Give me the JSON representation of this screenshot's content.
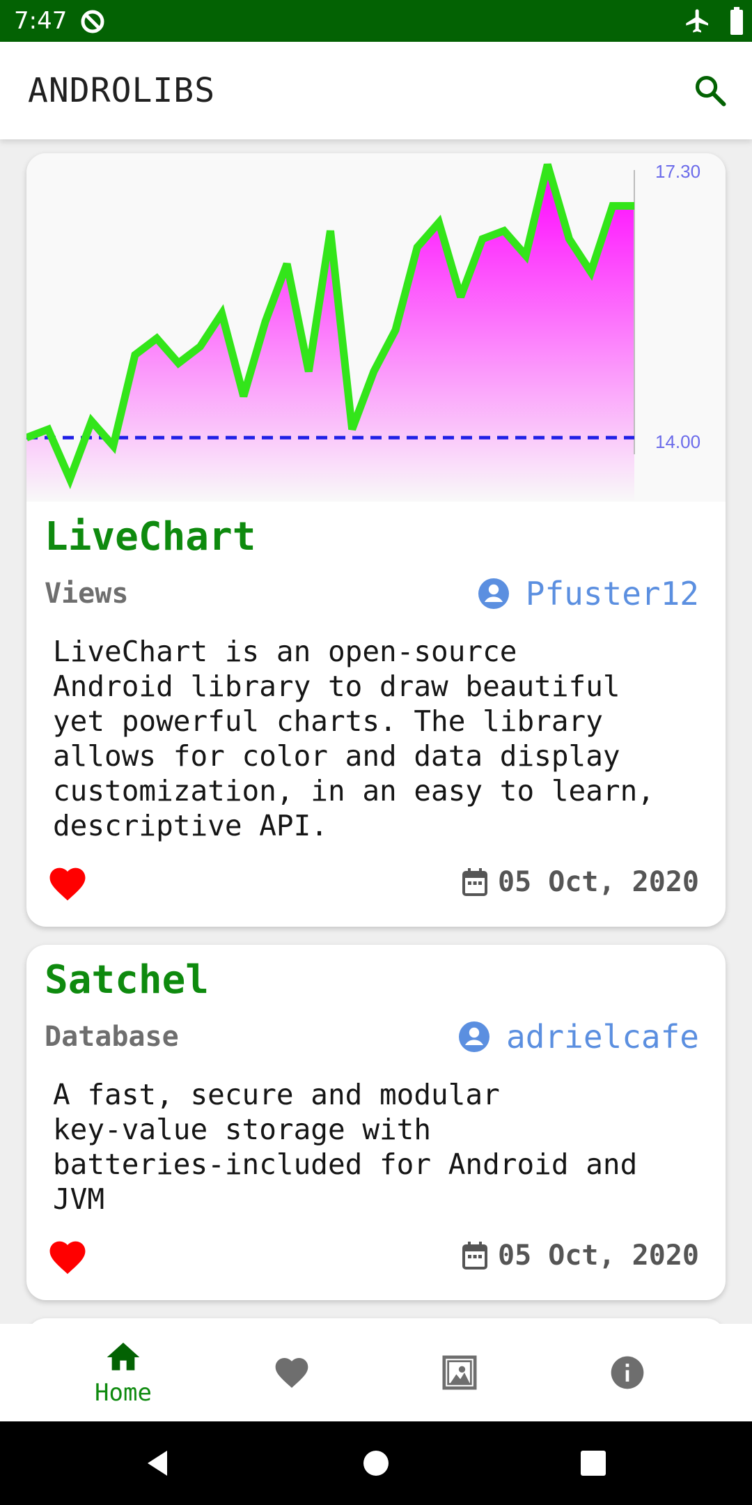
{
  "status_bar": {
    "time": "7:47",
    "icons": [
      "q-app-icon",
      "airplane-mode-icon",
      "battery-icon"
    ]
  },
  "app_bar": {
    "title": "ANDROLIBS",
    "search_icon": "search-icon"
  },
  "colors": {
    "primary": "#036203",
    "accent_green": "#0E8A0E",
    "author_blue": "#5B8FE0",
    "heart_red": "#FF0000",
    "chart_line": "#33E51A",
    "chart_fill": "#FF00FF",
    "baseline": "#1F1FE6"
  },
  "libraries": [
    {
      "name": "LiveChart",
      "category": "Views",
      "author": "Pfuster12",
      "description": "LiveChart is an open-source\nAndroid library to draw beautiful\nyet powerful charts. The library\nallows for color and data display\ncustomization, in an easy to learn,\ndescriptive API.",
      "date": "05 Oct, 2020",
      "favorited": true
    },
    {
      "name": "Satchel",
      "category": "Database",
      "author": "adrielcafe",
      "description": "A fast, secure and modular\nkey-value storage with\nbatteries-included for Android and\nJVM",
      "date": "05 Oct, 2020",
      "favorited": true
    }
  ],
  "chart_data": {
    "type": "area",
    "y_axis_labels": {
      "top": "17.30",
      "bottom": "14.00"
    },
    "ylim": [
      14.0,
      17.3
    ],
    "baseline": 14.1,
    "x": [
      0,
      1,
      2,
      3,
      4,
      5,
      6,
      7,
      8,
      9,
      10,
      11,
      12,
      13,
      14,
      15,
      16,
      17,
      18,
      19,
      20,
      21,
      22,
      23,
      24,
      25,
      26,
      27,
      28
    ],
    "values": [
      14.1,
      14.2,
      13.6,
      14.3,
      14.0,
      15.1,
      15.3,
      15.0,
      15.2,
      15.6,
      14.6,
      15.5,
      16.2,
      14.9,
      16.6,
      14.2,
      14.9,
      15.4,
      16.4,
      16.7,
      15.8,
      16.5,
      16.6,
      16.3,
      17.4,
      16.5,
      16.1,
      16.9,
      16.9
    ],
    "grid": false,
    "legend": "none"
  },
  "bottom_nav": {
    "items": [
      {
        "icon": "home-icon",
        "label": "Home",
        "active": true
      },
      {
        "icon": "heart-icon",
        "label": "",
        "active": false
      },
      {
        "icon": "gallery-icon",
        "label": "",
        "active": false
      },
      {
        "icon": "info-icon",
        "label": "",
        "active": false
      }
    ]
  },
  "system_nav": {
    "icons": [
      "back-icon",
      "home-circle-icon",
      "recents-icon"
    ]
  }
}
